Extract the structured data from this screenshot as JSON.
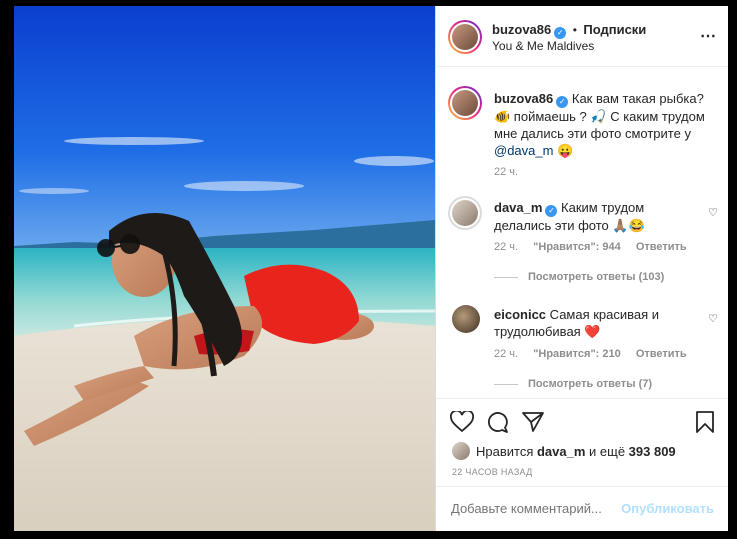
{
  "post": {
    "author": "buzova86",
    "follow_dot": "•",
    "follow_label": "Подписки",
    "location": "You & Me Maldives",
    "more": "⋯"
  },
  "caption": {
    "author": "buzova86",
    "text_1": "Как вам такая рыбка?",
    "emoji_1": "🐠",
    "text_2": " поймаешь ?",
    "emoji_2": "🎣",
    "text_3": " С каким трудом мне дались эти фото смотрите у ",
    "mention": "@dava_m",
    "emoji_3": "😛",
    "time": "22 ч."
  },
  "comments": [
    {
      "author": "dava_m",
      "verified": true,
      "text": "Каким трудом делались эти фото ",
      "emoji": "🙏🏽😂",
      "time": "22 ч.",
      "likes": "\"Нравится\": 944",
      "reply": "Ответить",
      "view_replies": "Посмотреть ответы (103)"
    },
    {
      "author": "eiconicc",
      "verified": false,
      "text": "Самая красивая и трудолюбивая ",
      "emoji": "❤️",
      "time": "22 ч.",
      "likes": "\"Нравится\": 210",
      "reply": "Ответить",
      "view_replies": "Посмотреть ответы (7)"
    }
  ],
  "likes": {
    "prefix": "Нравится ",
    "user": "dava_m",
    "suffix": " и ещё ",
    "count": "393 809"
  },
  "timestamp": "22 ЧАСОВ НАЗАД",
  "comment_box": {
    "placeholder": "Добавьте комментарий...",
    "publish": "Опубликовать"
  },
  "colors": {
    "accent": "#3897f0",
    "publish_disabled": "#b2dffc",
    "heart_red": "#ed4956"
  }
}
